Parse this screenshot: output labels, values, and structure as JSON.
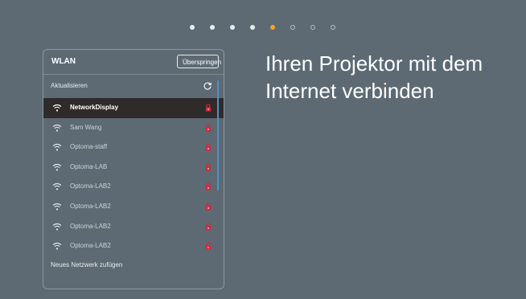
{
  "progress": {
    "steps": [
      {
        "state": "done"
      },
      {
        "state": "done"
      },
      {
        "state": "done"
      },
      {
        "state": "done"
      },
      {
        "state": "current"
      },
      {
        "state": "todo"
      },
      {
        "state": "todo"
      },
      {
        "state": "todo"
      }
    ],
    "colors": {
      "done": "#e8ecef",
      "current": "#f0a81c",
      "todo": "#b6bfc5"
    }
  },
  "headline": "Ihren Projektor mit dem Internet verbinden",
  "panel": {
    "title": "WLAN",
    "skip_label": "Überspringen",
    "refresh_label": "Aktualisieren",
    "refresh_icon": "refresh-icon",
    "add_network_label": "Neues Netzwerk zufügen",
    "networks": [
      {
        "name": "NetworkDisplay",
        "selected": true,
        "secured": true
      },
      {
        "name": "Sam Wang",
        "selected": false,
        "secured": true
      },
      {
        "name": "Optoma-staff",
        "selected": false,
        "secured": true
      },
      {
        "name": "Optoma-LAB",
        "selected": false,
        "secured": true
      },
      {
        "name": "Optoma-LAB2",
        "selected": false,
        "secured": true
      },
      {
        "name": "Optoma-LAB2",
        "selected": false,
        "secured": true
      },
      {
        "name": "Optoma-LAB2",
        "selected": false,
        "secured": true
      },
      {
        "name": "Optoma-LAB2",
        "selected": false,
        "secured": true
      }
    ],
    "colors": {
      "lock": "#d9253a",
      "selected_row": "#2f2b2b",
      "scrollbar": "#4f8fce"
    }
  }
}
